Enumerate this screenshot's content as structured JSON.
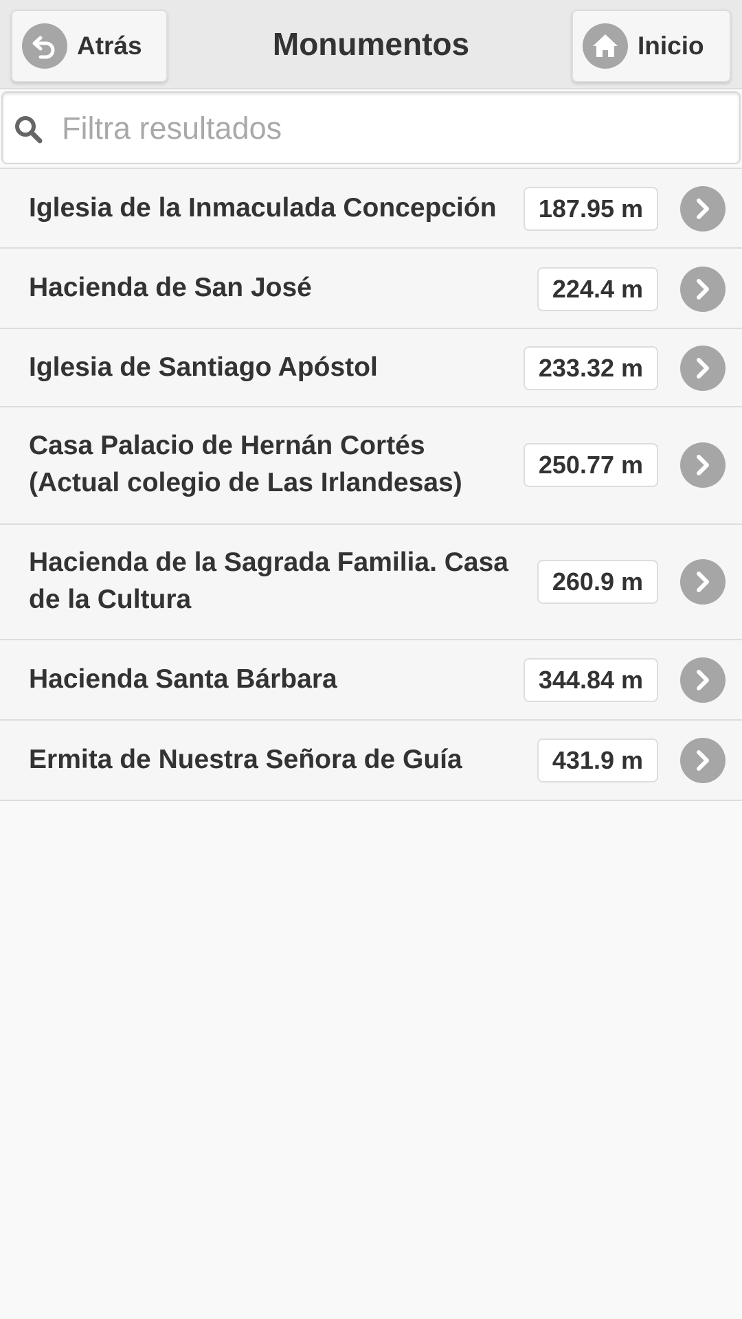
{
  "header": {
    "title": "Monumentos",
    "back_label": "Atrás",
    "home_label": "Inicio"
  },
  "search": {
    "placeholder": "Filtra resultados",
    "value": ""
  },
  "monuments": [
    {
      "name": "Iglesia de la Inmaculada Concepción",
      "distance": "187.95 m"
    },
    {
      "name": "Hacienda de San José",
      "distance": "224.4 m"
    },
    {
      "name": "Iglesia de Santiago Apóstol",
      "distance": "233.32 m"
    },
    {
      "name": "Casa Palacio de Hernán Cortés (Actual colegio de Las Irlandesas)",
      "distance": "250.77 m"
    },
    {
      "name": "Hacienda de la Sagrada Familia. Casa de la Cultura",
      "distance": "260.9 m"
    },
    {
      "name": "Hacienda Santa Bárbara",
      "distance": "344.84 m"
    },
    {
      "name": "Ermita de Nuestra Señora de Guía",
      "distance": "431.9 m"
    }
  ],
  "icons": {
    "back": "back-arrow-icon",
    "home": "home-icon",
    "search": "search-icon",
    "row": "chevron-right-icon"
  },
  "colors": {
    "header_bg": "#e9e9e9",
    "icon_disc": "#a6a6a6",
    "text": "#333333",
    "placeholder": "#a9a9a9"
  }
}
